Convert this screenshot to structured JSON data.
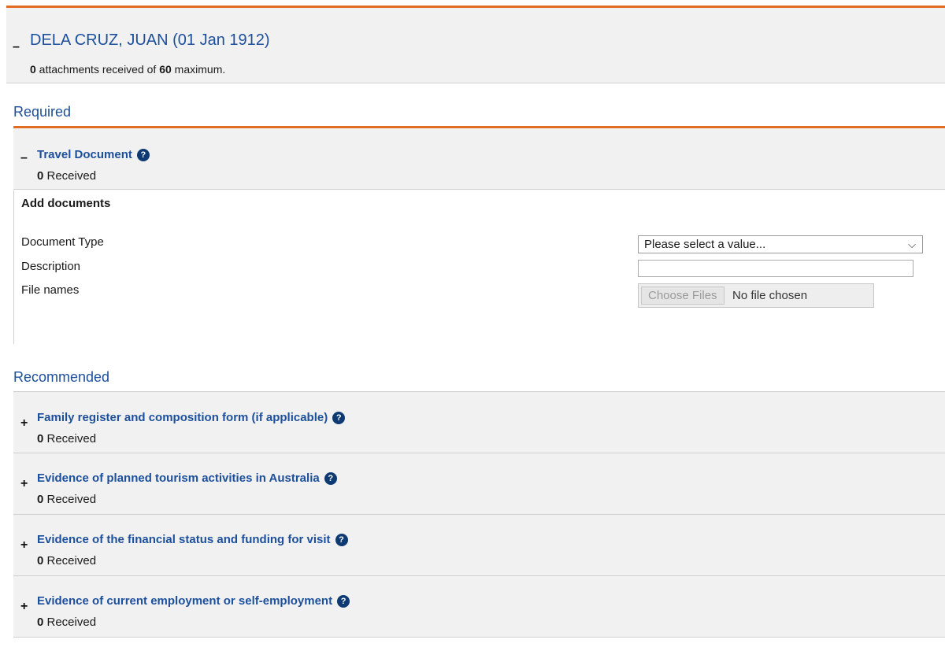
{
  "applicant": {
    "toggle": "–",
    "name": "DELA CRUZ, JUAN (01 Jan 1912)",
    "received_count": "0",
    "received_text": " attachments received of ",
    "maximum": "60",
    "maximum_text": " maximum."
  },
  "required": {
    "title": "Required",
    "documents": [
      {
        "toggle": "–",
        "title": "Travel Document",
        "count": "0",
        "count_label": " Received"
      }
    ],
    "add_documents": {
      "title": "Add documents",
      "document_type_label": "Document Type",
      "description_label": "Description",
      "file_names_label": "File names",
      "select_value": "Please select a value...",
      "description_value": "",
      "choose_files_label": "Choose Files",
      "file_status": "No file chosen"
    }
  },
  "recommended": {
    "title": "Recommended",
    "documents": [
      {
        "toggle": "+",
        "title": "Family register and composition form (if applicable)",
        "count": "0",
        "count_label": " Received"
      },
      {
        "toggle": "+",
        "title": "Evidence of planned tourism activities in Australia",
        "count": "0",
        "count_label": " Received"
      },
      {
        "toggle": "+",
        "title": "Evidence of the financial status and funding for visit",
        "count": "0",
        "count_label": " Received"
      },
      {
        "toggle": "+",
        "title": "Evidence of current employment or self-employment",
        "count": "0",
        "count_label": " Received"
      }
    ]
  },
  "icons": {
    "help": "?",
    "dropdown": "⌵"
  },
  "colors": {
    "accent": "#e06d21",
    "link": "#1c4f9c",
    "help_icon": "#0d3a73",
    "panel": "#f1f1f1"
  }
}
